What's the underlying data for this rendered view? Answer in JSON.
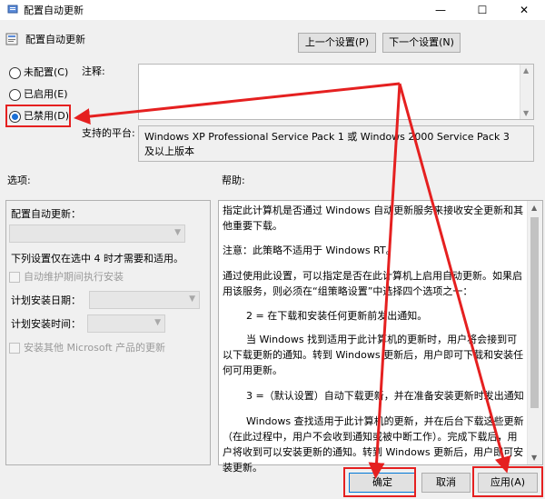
{
  "window": {
    "title": "配置自动更新",
    "minimize_glyph": "—",
    "maximize_glyph": "☐",
    "close_glyph": "✕"
  },
  "header": {
    "title": "配置自动更新",
    "prev_label": "上一个设置(P)",
    "next_label": "下一个设置(N)"
  },
  "state": {
    "options": [
      {
        "label": "未配置(C)",
        "selected": false
      },
      {
        "label": "已启用(E)",
        "selected": false
      },
      {
        "label": "已禁用(D)",
        "selected": true
      }
    ]
  },
  "comment": {
    "label": "注释:",
    "value": ""
  },
  "platform": {
    "label": "支持的平台:",
    "value": "Windows XP Professional Service Pack 1 或 Windows 2000 Service Pack 3 及以上版本"
  },
  "options_panel": {
    "label": "选项:",
    "title": "配置自动更新：",
    "note": "下列设置仅在选中 4 时才需要和适用。",
    "maint_checkbox": "自动维护期间执行安装",
    "day_label": "计划安装日期：",
    "time_label": "计划安装时间：",
    "other_checkbox": "安装其他 Microsoft 产品的更新"
  },
  "help_panel": {
    "label": "帮助:",
    "paragraphs": [
      "指定此计算机是否通过 Windows 自动更新服务来接收安全更新和其他重要下载。",
      "注意：此策略不适用于 Windows RT。",
      "通过使用此设置，可以指定是否在此计算机上启用自动更新。如果启用该服务，则必须在“组策略设置”中选择四个选项之一：",
      "2 = 在下载和安装任何更新前发出通知。",
      "当 Windows 找到适用于此计算机的更新时，用户将会接到可以下载更新的通知。转到 Windows 更新后，用户即可下载和安装任何可用更新。",
      "3 =（默认设置）自动下载更新，并在准备安装更新时发出通知",
      "Windows 查找适用于此计算机的更新，并在后台下载这些更新（在此过程中，用户不会收到通知或被中断工作）。完成下载后，用户将收到可以安装更新的通知。转到 Windows 更新后，用户即可安装更新。"
    ]
  },
  "footer": {
    "ok_label": "确定",
    "cancel_label": "取消",
    "apply_label": "应用(A)"
  },
  "colors": {
    "annotation_red": "#e52020",
    "selected_radio": "#1a6fd6"
  }
}
